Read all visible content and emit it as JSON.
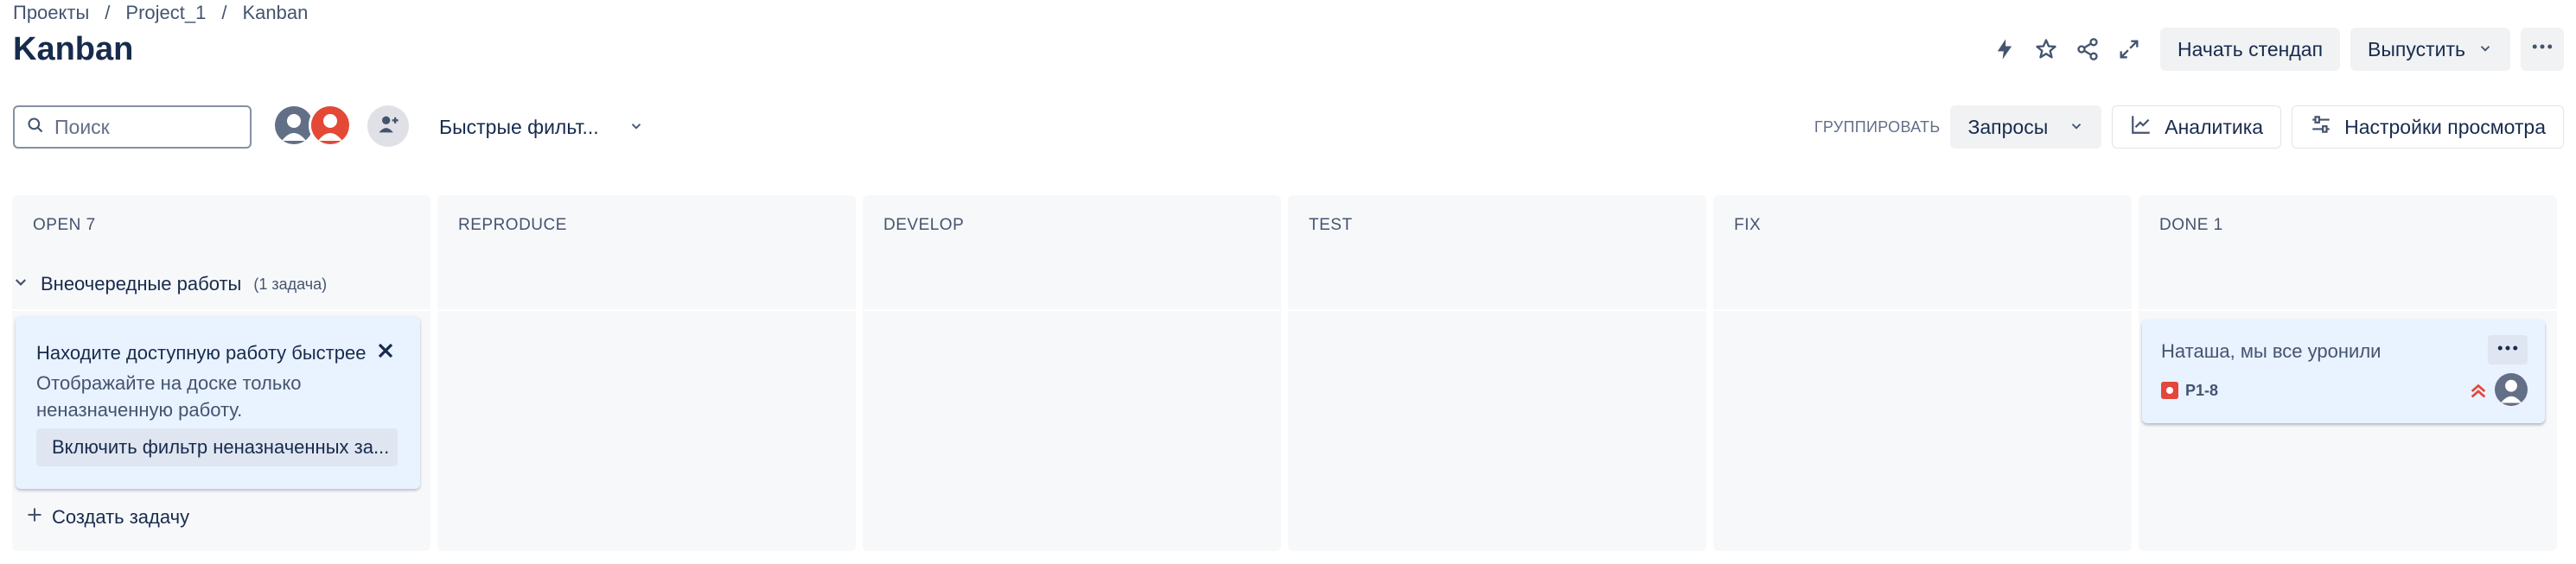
{
  "breadcrumb": {
    "items": [
      "Проекты",
      "Project_1",
      "Kanban"
    ],
    "separator": "/"
  },
  "page": {
    "title": "Kanban"
  },
  "header_actions": {
    "icons": [
      "lightning-icon",
      "star-icon",
      "share-icon",
      "expand-icon"
    ],
    "standup_label": "Начать стендап",
    "release_label": "Выпустить",
    "more_icon": "more-icon"
  },
  "toolbar": {
    "search_placeholder": "Поиск",
    "quick_filters_label": "Быстрые фильт...",
    "group_by_label": "ГРУППИРОВАТЬ",
    "group_by_value": "Запросы",
    "analytics_label": "Аналитика",
    "view_settings_label": "Настройки просмотра"
  },
  "columns": [
    {
      "name": "OPEN 7"
    },
    {
      "name": "REPRODUCE"
    },
    {
      "name": "DEVELOP"
    },
    {
      "name": "TEST"
    },
    {
      "name": "FIX"
    },
    {
      "name": "DONE 1"
    }
  ],
  "swimlane": {
    "title": "Внеочередные работы",
    "count": "(1 задача)"
  },
  "onboarding": {
    "title": "Находите доступную работу быстрее",
    "description": "Отображайте на доске только неназначенную работу.",
    "action": "Включить фильтр неназначенных за..."
  },
  "create_task_label": "Создать задачу",
  "issue": {
    "summary": "Наташа, мы все уронили",
    "key": "P1-8",
    "type_color": "#e2483d",
    "priority": "highest",
    "priority_color": "#e2483d"
  },
  "colors": {
    "accent": "#0c66e4",
    "avatar_orange": "#e34935",
    "avatar_gray": "#626f86"
  }
}
